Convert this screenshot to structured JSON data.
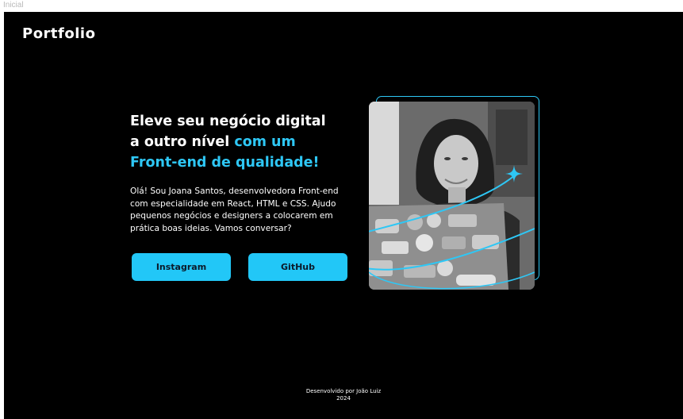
{
  "frame": {
    "label": "Inicial"
  },
  "header": {
    "brand": "Portfolio"
  },
  "hero": {
    "headline_line1": "Eleve seu negócio digital",
    "headline_line2_plain": "a outro nível ",
    "headline_line2_accent": "com um",
    "headline_line3_accent": "Front-end de qualidade!",
    "intro": "Olá! Sou Joana Santos, desenvolvedora Front-end com especialidade em React, HTML e CSS. Ajudo pequenos negócios e designers a colocarem em prática boas ideias. Vamos conversar?",
    "instagram_label": "Instagram",
    "github_label": "GitHub"
  },
  "photo": {
    "icon": "sparkle-icon"
  },
  "footer": {
    "credit": "Desenvolvido por João Luiz",
    "year": "2024"
  },
  "colors": {
    "background": "#000000",
    "accent": "#2ec7f5",
    "button": "#22c7f7",
    "text": "#ffffff"
  }
}
